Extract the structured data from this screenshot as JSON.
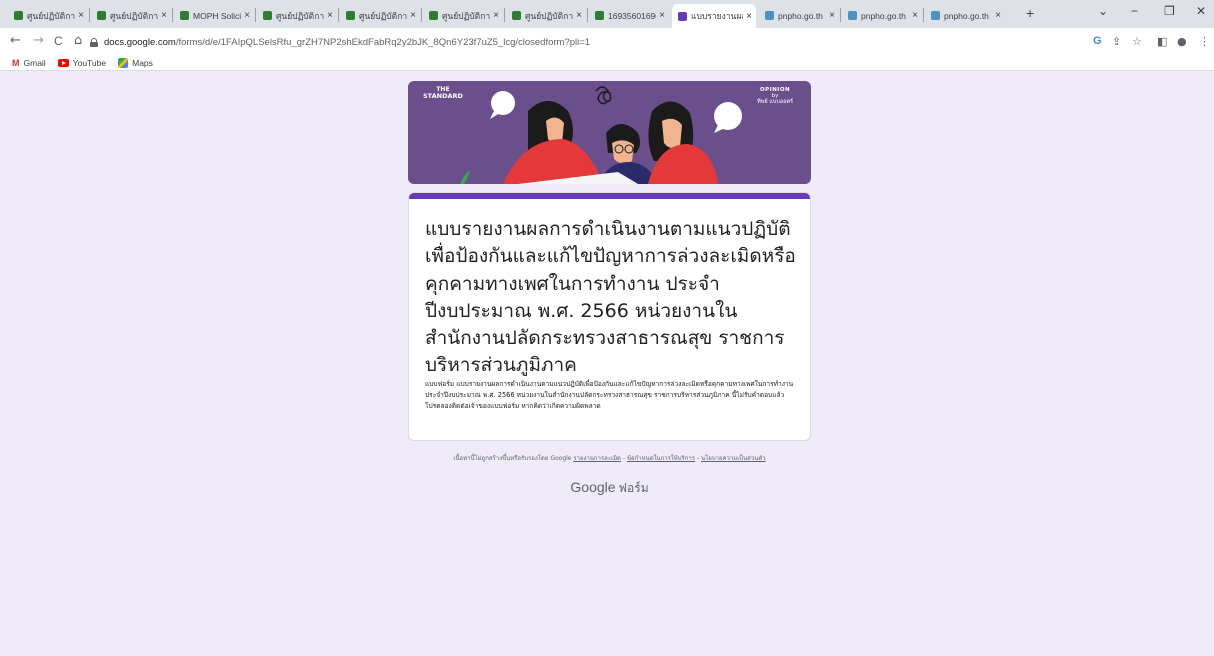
{
  "browser": {
    "tabs": [
      {
        "title": "ศูนย์ปฏิบัติการ",
        "favicon": "green"
      },
      {
        "title": "ศูนย์ปฏิบัติการ",
        "favicon": "green"
      },
      {
        "title": "MOPH Solicit",
        "favicon": "green"
      },
      {
        "title": "ศูนย์ปฏิบัติการ",
        "favicon": "green"
      },
      {
        "title": "ศูนย์ปฏิบัติการ",
        "favicon": "green"
      },
      {
        "title": "ศูนย์ปฏิบัติการ",
        "favicon": "green"
      },
      {
        "title": "ศูนย์ปฏิบัติการ",
        "favicon": "green"
      },
      {
        "title": "16935601690",
        "favicon": "green"
      },
      {
        "title": "แบบรายงานผล",
        "favicon": "purple",
        "active": true
      },
      {
        "title": "pnpho.go.th",
        "favicon": "blue"
      },
      {
        "title": "pnpho.go.th",
        "favicon": "blue"
      },
      {
        "title": "pnpho.go.th",
        "favicon": "blue"
      }
    ],
    "tab_close_glyph": "×",
    "new_tab_glyph": "+",
    "window_controls": {
      "dropdown": "⌄",
      "minimize": "−",
      "maximize": "❐",
      "close": "✕"
    },
    "nav": {
      "back": "←",
      "forward": "→",
      "reload": "C",
      "home": "⌂"
    },
    "url": {
      "host": "docs.google.com",
      "path": "/forms/d/e/1FAIpQLSelsRfu_grZH7NP2shEkdFabRq2y2bJK_8Qn6Y23f7uZ5_lcg/closedform?pli=1"
    },
    "toolbar_icons": {
      "google": "G",
      "share": "⇪",
      "bookmark": "☆",
      "sidepanel": "◧",
      "profile": "●",
      "menu": "⋮"
    },
    "bookmarks": [
      {
        "label": "Gmail",
        "icon": "gmail-icon"
      },
      {
        "label": "YouTube",
        "icon": "youtube-icon"
      },
      {
        "label": "Maps",
        "icon": "maps-icon"
      }
    ]
  },
  "banner": {
    "brand_line1": "THE",
    "brand_line2": "STANDARD",
    "opinion_line1": "OPINION",
    "opinion_line2": "by",
    "opinion_line3": "ทิพย์ แบบออตร์",
    "colors": {
      "background": "#6a4f8c",
      "figure_red": "#e5383b",
      "hair": "#1b1b1b",
      "skin": "#f2b48f"
    }
  },
  "form": {
    "accent": "#673ab7",
    "title": "แบบรายงานผลการดำเนินงานตามแนวปฏิบัติเพื่อป้องกันและแก้ไขปัญหาการล่วงละเมิดหรือคุกคามทางเพศในการทำงาน ประจำปีงบประมาณ พ.ศ. 2566 หน่วยงานในสำนักงานปลัดกระทรวงสาธารณสุข  ราชการบริหารส่วนภูมิภาค",
    "description": "แบบฟอร์ม แบบรายงานผลการดำเนินงานตามแนวปฏิบัติเพื่อป้องกันและแก้ไขปัญหาการล่วงละเมิดหรือคุกคามทางเพศในการทำงาน ประจำปีงบประมาณ พ.ศ. 2566 หน่วยงานในสำนักงานปลัดกระทรวงสาธารณสุข  ราชการบริหารส่วนภูมิภาค   นี้ไม่รับคำตอบแล้ว",
    "contact": "โปรดลองติดต่อเจ้าของแบบฟอร์ม หากคิดว่าเกิดความผิดพลาด"
  },
  "footer": {
    "note": "เนื้อหานี้ไม่ถูกสร้างขึ้นหรือรับรองโดย Google",
    "report_link": "รายงานการละเมิด",
    "sep": " - ",
    "terms_link": "ข้อกำหนดในการให้บริการ",
    "privacy_link": "นโยบายความเป็นส่วนตัว",
    "logo_google": "Google",
    "logo_forms": "ฟอร์ม"
  }
}
